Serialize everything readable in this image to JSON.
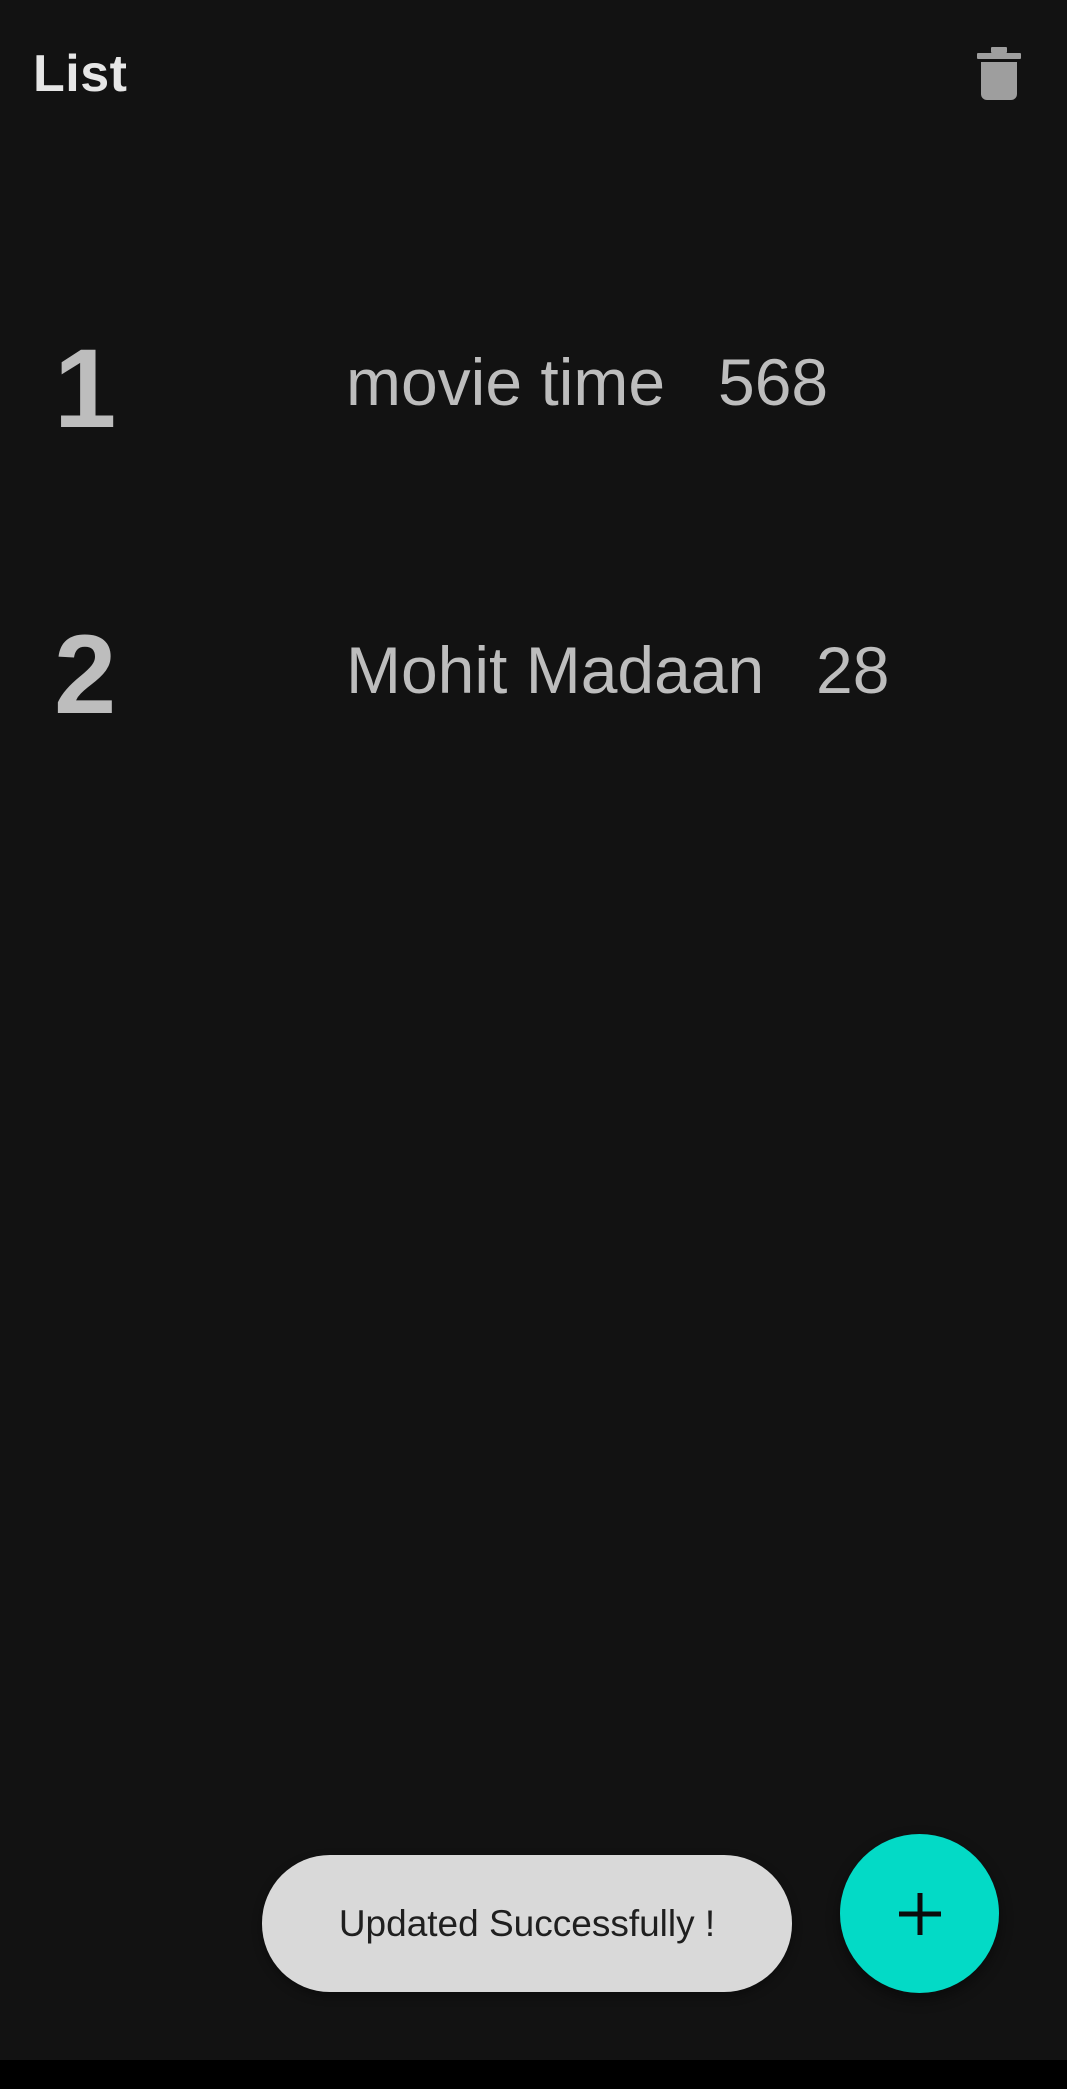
{
  "app_bar": {
    "title": "List",
    "delete_icon": "trash-icon"
  },
  "list": {
    "items": [
      {
        "index": "1",
        "name": "movie time",
        "value": "568"
      },
      {
        "index": "2",
        "name": "Mohit Madaan",
        "value": "28"
      }
    ]
  },
  "toast": {
    "message": "Updated Successfully !"
  },
  "fab": {
    "icon": "plus-icon"
  },
  "colors": {
    "background": "#121212",
    "text": "#bdbdbd",
    "title": "#e6e6e6",
    "accent": "#03dac6",
    "toast_bg": "#d9d9d9"
  }
}
